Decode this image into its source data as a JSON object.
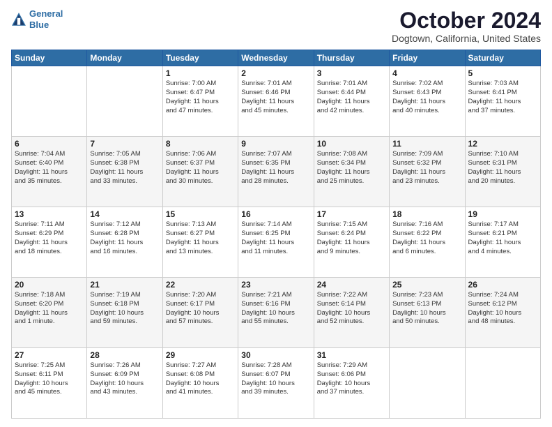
{
  "header": {
    "logo_line1": "General",
    "logo_line2": "Blue",
    "month": "October 2024",
    "location": "Dogtown, California, United States"
  },
  "days_of_week": [
    "Sunday",
    "Monday",
    "Tuesday",
    "Wednesday",
    "Thursday",
    "Friday",
    "Saturday"
  ],
  "weeks": [
    [
      {
        "day": "",
        "content": ""
      },
      {
        "day": "",
        "content": ""
      },
      {
        "day": "1",
        "content": "Sunrise: 7:00 AM\nSunset: 6:47 PM\nDaylight: 11 hours\nand 47 minutes."
      },
      {
        "day": "2",
        "content": "Sunrise: 7:01 AM\nSunset: 6:46 PM\nDaylight: 11 hours\nand 45 minutes."
      },
      {
        "day": "3",
        "content": "Sunrise: 7:01 AM\nSunset: 6:44 PM\nDaylight: 11 hours\nand 42 minutes."
      },
      {
        "day": "4",
        "content": "Sunrise: 7:02 AM\nSunset: 6:43 PM\nDaylight: 11 hours\nand 40 minutes."
      },
      {
        "day": "5",
        "content": "Sunrise: 7:03 AM\nSunset: 6:41 PM\nDaylight: 11 hours\nand 37 minutes."
      }
    ],
    [
      {
        "day": "6",
        "content": "Sunrise: 7:04 AM\nSunset: 6:40 PM\nDaylight: 11 hours\nand 35 minutes."
      },
      {
        "day": "7",
        "content": "Sunrise: 7:05 AM\nSunset: 6:38 PM\nDaylight: 11 hours\nand 33 minutes."
      },
      {
        "day": "8",
        "content": "Sunrise: 7:06 AM\nSunset: 6:37 PM\nDaylight: 11 hours\nand 30 minutes."
      },
      {
        "day": "9",
        "content": "Sunrise: 7:07 AM\nSunset: 6:35 PM\nDaylight: 11 hours\nand 28 minutes."
      },
      {
        "day": "10",
        "content": "Sunrise: 7:08 AM\nSunset: 6:34 PM\nDaylight: 11 hours\nand 25 minutes."
      },
      {
        "day": "11",
        "content": "Sunrise: 7:09 AM\nSunset: 6:32 PM\nDaylight: 11 hours\nand 23 minutes."
      },
      {
        "day": "12",
        "content": "Sunrise: 7:10 AM\nSunset: 6:31 PM\nDaylight: 11 hours\nand 20 minutes."
      }
    ],
    [
      {
        "day": "13",
        "content": "Sunrise: 7:11 AM\nSunset: 6:29 PM\nDaylight: 11 hours\nand 18 minutes."
      },
      {
        "day": "14",
        "content": "Sunrise: 7:12 AM\nSunset: 6:28 PM\nDaylight: 11 hours\nand 16 minutes."
      },
      {
        "day": "15",
        "content": "Sunrise: 7:13 AM\nSunset: 6:27 PM\nDaylight: 11 hours\nand 13 minutes."
      },
      {
        "day": "16",
        "content": "Sunrise: 7:14 AM\nSunset: 6:25 PM\nDaylight: 11 hours\nand 11 minutes."
      },
      {
        "day": "17",
        "content": "Sunrise: 7:15 AM\nSunset: 6:24 PM\nDaylight: 11 hours\nand 9 minutes."
      },
      {
        "day": "18",
        "content": "Sunrise: 7:16 AM\nSunset: 6:22 PM\nDaylight: 11 hours\nand 6 minutes."
      },
      {
        "day": "19",
        "content": "Sunrise: 7:17 AM\nSunset: 6:21 PM\nDaylight: 11 hours\nand 4 minutes."
      }
    ],
    [
      {
        "day": "20",
        "content": "Sunrise: 7:18 AM\nSunset: 6:20 PM\nDaylight: 11 hours\nand 1 minute."
      },
      {
        "day": "21",
        "content": "Sunrise: 7:19 AM\nSunset: 6:18 PM\nDaylight: 10 hours\nand 59 minutes."
      },
      {
        "day": "22",
        "content": "Sunrise: 7:20 AM\nSunset: 6:17 PM\nDaylight: 10 hours\nand 57 minutes."
      },
      {
        "day": "23",
        "content": "Sunrise: 7:21 AM\nSunset: 6:16 PM\nDaylight: 10 hours\nand 55 minutes."
      },
      {
        "day": "24",
        "content": "Sunrise: 7:22 AM\nSunset: 6:14 PM\nDaylight: 10 hours\nand 52 minutes."
      },
      {
        "day": "25",
        "content": "Sunrise: 7:23 AM\nSunset: 6:13 PM\nDaylight: 10 hours\nand 50 minutes."
      },
      {
        "day": "26",
        "content": "Sunrise: 7:24 AM\nSunset: 6:12 PM\nDaylight: 10 hours\nand 48 minutes."
      }
    ],
    [
      {
        "day": "27",
        "content": "Sunrise: 7:25 AM\nSunset: 6:11 PM\nDaylight: 10 hours\nand 45 minutes."
      },
      {
        "day": "28",
        "content": "Sunrise: 7:26 AM\nSunset: 6:09 PM\nDaylight: 10 hours\nand 43 minutes."
      },
      {
        "day": "29",
        "content": "Sunrise: 7:27 AM\nSunset: 6:08 PM\nDaylight: 10 hours\nand 41 minutes."
      },
      {
        "day": "30",
        "content": "Sunrise: 7:28 AM\nSunset: 6:07 PM\nDaylight: 10 hours\nand 39 minutes."
      },
      {
        "day": "31",
        "content": "Sunrise: 7:29 AM\nSunset: 6:06 PM\nDaylight: 10 hours\nand 37 minutes."
      },
      {
        "day": "",
        "content": ""
      },
      {
        "day": "",
        "content": ""
      }
    ]
  ]
}
